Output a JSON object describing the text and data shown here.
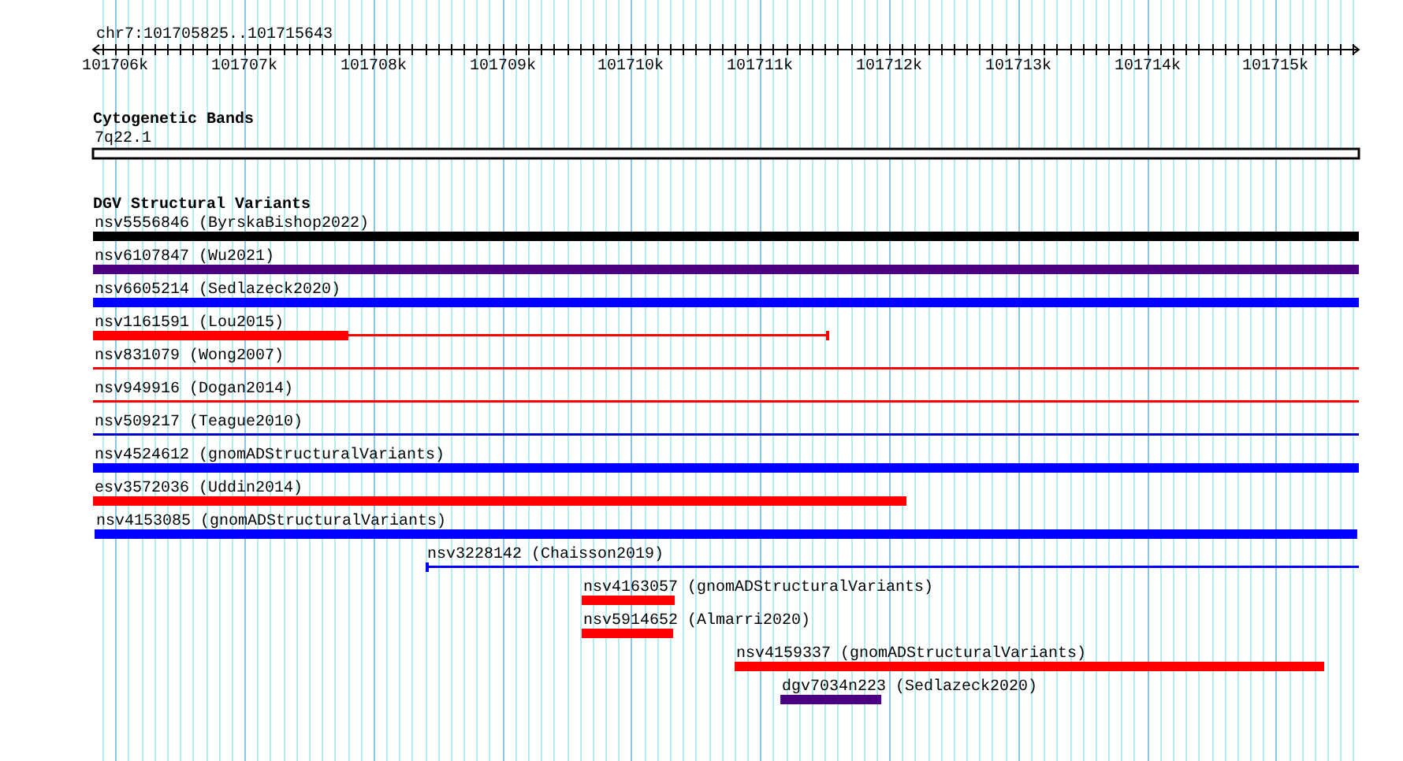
{
  "genome_view": {
    "location": "chr7:101705825..101715643",
    "ruler": {
      "tick_labels": [
        "101706k",
        "101707k",
        "101708k",
        "101709k",
        "101710k",
        "101711k",
        "101712k",
        "101713k",
        "101714k",
        "101715k"
      ]
    },
    "tracks": [
      {
        "kind": "cytoband",
        "title": "Cytogenetic Bands",
        "band": "7q22.1"
      },
      {
        "kind": "variants",
        "title": "DGV Structural Variants",
        "features": [
          {
            "label": "nsv5556846 (ByrskaBishop2022)",
            "color": "#000000",
            "kind": "plain"
          },
          {
            "label": "nsv6107847 (Wu2021)",
            "color": "#4b0082",
            "kind": "plain"
          },
          {
            "label": "nsv6605214 (Sedlazeck2020)",
            "color": "#0000ff",
            "kind": "plain"
          },
          {
            "label": "nsv1161591 (Lou2015)",
            "color": "#ff0000",
            "kind": "end_tick"
          },
          {
            "label": "nsv831079 (Wong2007)",
            "color": "#ff0000",
            "kind": "plain"
          },
          {
            "label": "nsv949916 (Dogan2014)",
            "color": "#ff0000",
            "kind": "plain"
          },
          {
            "label": "nsv509217 (Teague2010)",
            "color": "#0000cc",
            "kind": "plain"
          },
          {
            "label": "nsv4524612 (gnomADStructuralVariants)",
            "color": "#0000ff",
            "kind": "plain"
          },
          {
            "label": "esv3572036 (Uddin2014)",
            "color": "#ff0000",
            "kind": "plain"
          },
          {
            "label": "nsv4153085 (gnomADStructuralVariants)",
            "color": "#0000ff",
            "kind": "plain"
          },
          {
            "label": "nsv3228142 (Chaisson2019)",
            "color": "#0000ff",
            "kind": "start_tick"
          },
          {
            "label": "nsv4163057 (gnomADStructuralVariants)",
            "color": "#ff0000",
            "kind": "plain"
          },
          {
            "label": "nsv5914652 (Almarri2020)",
            "color": "#ff0000",
            "kind": "plain"
          },
          {
            "label": "nsv4159337 (gnomADStructuralVariants)",
            "color": "#ff0000",
            "kind": "plain"
          },
          {
            "label": "dgv7034n223 (Sedlazeck2020)",
            "color": "#4b0082",
            "kind": "plain"
          }
        ]
      }
    ]
  }
}
